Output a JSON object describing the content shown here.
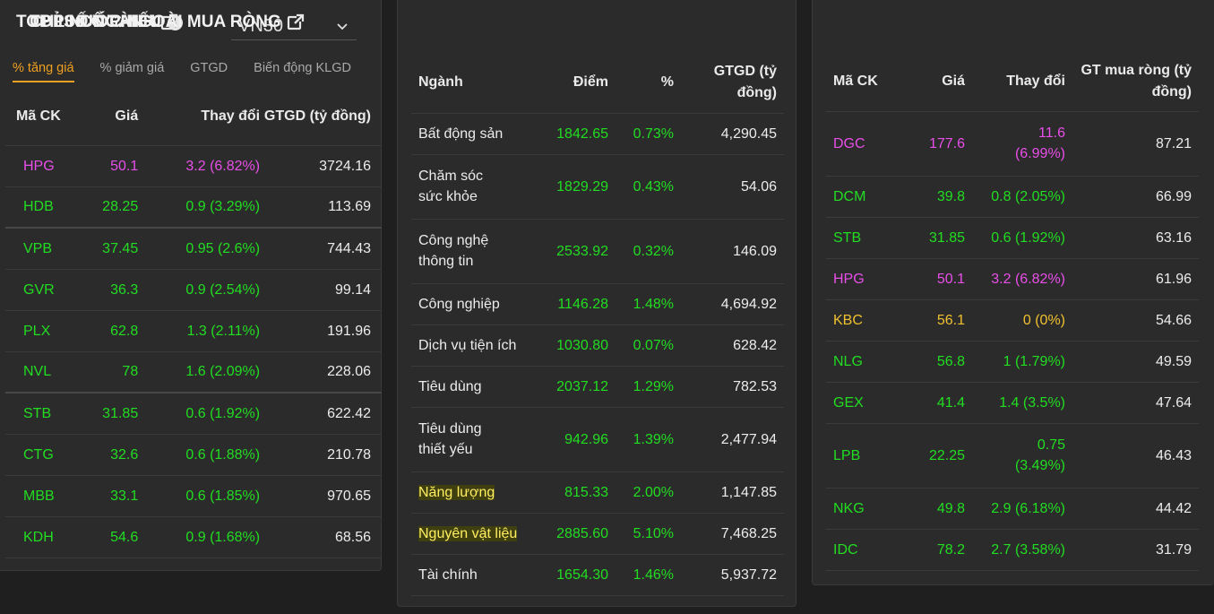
{
  "top10": {
    "title": "TOP 10 CỔ PHIẾU",
    "select_value": "VN30",
    "tabs": [
      "% tăng giá",
      "% giảm giá",
      "GTGD",
      "Biến động KLGD"
    ],
    "headers": [
      "Mã CK",
      "Giá",
      "Thay đổi",
      "GTGD (tỷ đồng)"
    ],
    "rows": [
      {
        "code": "HPG",
        "price": "50.1",
        "change": "3.2 (6.82%)",
        "value": "3724.16",
        "color": "ceil"
      },
      {
        "code": "HDB",
        "price": "28.25",
        "change": "0.9 (3.29%)",
        "value": "113.69",
        "color": "up"
      },
      {
        "code": "VPB",
        "price": "37.45",
        "change": "0.95 (2.6%)",
        "value": "744.43",
        "color": "up"
      },
      {
        "code": "GVR",
        "price": "36.3",
        "change": "0.9 (2.54%)",
        "value": "99.14",
        "color": "up"
      },
      {
        "code": "PLX",
        "price": "62.8",
        "change": "1.3 (2.11%)",
        "value": "191.96",
        "color": "up"
      },
      {
        "code": "NVL",
        "price": "78",
        "change": "1.6 (2.09%)",
        "value": "228.06",
        "color": "up"
      },
      {
        "code": "STB",
        "price": "31.85",
        "change": "0.6 (1.92%)",
        "value": "622.42",
        "color": "up"
      },
      {
        "code": "CTG",
        "price": "32.6",
        "change": "0.6 (1.88%)",
        "value": "210.78",
        "color": "up"
      },
      {
        "code": "MBB",
        "price": "33.1",
        "change": "0.6 (1.85%)",
        "value": "970.65",
        "color": "up"
      },
      {
        "code": "KDH",
        "price": "54.6",
        "change": "0.9 (1.68%)",
        "value": "68.56",
        "color": "up"
      }
    ]
  },
  "sector": {
    "title": "CHỈ SỐ NGÀNH",
    "headers": [
      "Ngành",
      "Điểm",
      "%",
      "GTGD (tỷ đồng)"
    ],
    "rows": [
      {
        "name": "Bất động sản",
        "point": "1842.65",
        "pct": "0.73%",
        "value": "4,290.45"
      },
      {
        "name": "Chăm sóc sức khỏe",
        "point": "1829.29",
        "pct": "0.43%",
        "value": "54.06"
      },
      {
        "name": "Công nghệ thông tin",
        "point": "2533.92",
        "pct": "0.32%",
        "value": "146.09"
      },
      {
        "name": "Công nghiệp",
        "point": "1146.28",
        "pct": "1.48%",
        "value": "4,694.92"
      },
      {
        "name": "Dịch vụ tiện ích",
        "point": "1030.80",
        "pct": "0.07%",
        "value": "628.42"
      },
      {
        "name": "Tiêu dùng",
        "point": "2037.12",
        "pct": "1.29%",
        "value": "782.53"
      },
      {
        "name": "Tiêu dùng thiết yếu",
        "point": "942.96",
        "pct": "1.39%",
        "value": "2,477.94"
      },
      {
        "name": "Năng lượng",
        "point": "815.33",
        "pct": "2.00%",
        "value": "1,147.85"
      },
      {
        "name": "Nguyên vật liệu",
        "point": "2885.60",
        "pct": "5.10%",
        "value": "7,468.25"
      },
      {
        "name": "Tài chính",
        "point": "1654.30",
        "pct": "1.46%",
        "value": "5,937.72"
      }
    ]
  },
  "foreign": {
    "title": "TOP NƯỚC NGOÀI MUA RÒNG",
    "headers": [
      "Mã CK",
      "Giá",
      "Thay đổi",
      "GT mua ròng (tỷ đồng)"
    ],
    "rows": [
      {
        "code": "DGC",
        "price": "177.6",
        "change": "11.6 (6.99%)",
        "value": "87.21",
        "color": "ceil"
      },
      {
        "code": "DCM",
        "price": "39.8",
        "change": "0.8 (2.05%)",
        "value": "66.99",
        "color": "up"
      },
      {
        "code": "STB",
        "price": "31.85",
        "change": "0.6 (1.92%)",
        "value": "63.16",
        "color": "up"
      },
      {
        "code": "HPG",
        "price": "50.1",
        "change": "3.2 (6.82%)",
        "value": "61.96",
        "color": "ceil"
      },
      {
        "code": "KBC",
        "price": "56.1",
        "change": "0 (0%)",
        "value": "54.66",
        "color": "ref"
      },
      {
        "code": "NLG",
        "price": "56.8",
        "change": "1 (1.79%)",
        "value": "49.59",
        "color": "up"
      },
      {
        "code": "GEX",
        "price": "41.4",
        "change": "1.4 (3.5%)",
        "value": "47.64",
        "color": "up"
      },
      {
        "code": "LPB",
        "price": "22.25",
        "change": "0.75 (3.49%)",
        "value": "46.43",
        "color": "up"
      },
      {
        "code": "NKG",
        "price": "49.8",
        "change": "2.9 (6.18%)",
        "value": "44.42",
        "color": "up"
      },
      {
        "code": "IDC",
        "price": "78.2",
        "change": "2.7 (3.58%)",
        "value": "31.79",
        "color": "up"
      }
    ]
  },
  "colors": {
    "up": "#22dd22",
    "ceil": "#e84ee8",
    "ref": "#f0c030",
    "accent": "#f0a020"
  },
  "icons": {
    "info": "info-icon",
    "external": "external-link-icon",
    "dropdown": "chevron-down-icon"
  }
}
